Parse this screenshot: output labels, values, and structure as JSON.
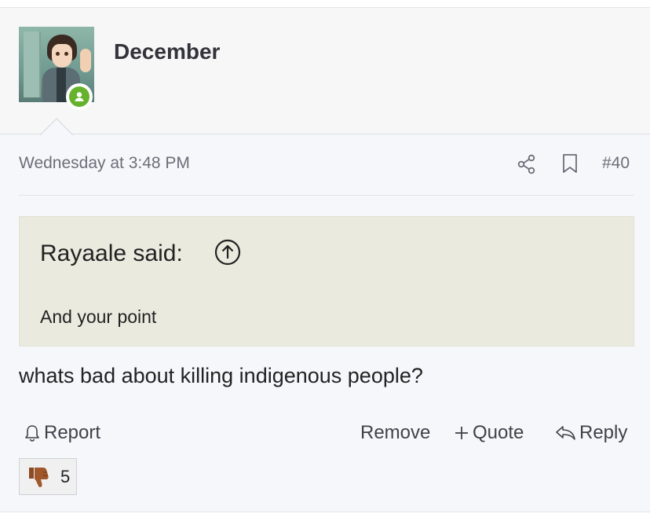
{
  "post": {
    "username": "December",
    "timestamp": "Wednesday at 3:48 PM",
    "post_number": "#40",
    "message": "whats bad about killing indigenous people?"
  },
  "quote": {
    "author_line": "Rayaale said:",
    "text": "And your point"
  },
  "actions": {
    "report": "Report",
    "remove": "Remove",
    "quote": "Quote",
    "reply": "Reply"
  },
  "reaction": {
    "icon": "thumbs-down-icon",
    "count": "5"
  },
  "colors": {
    "online_indicator": "#66b22d",
    "quote_background": "#ebeadf",
    "page_background": "#f6f7fa"
  }
}
